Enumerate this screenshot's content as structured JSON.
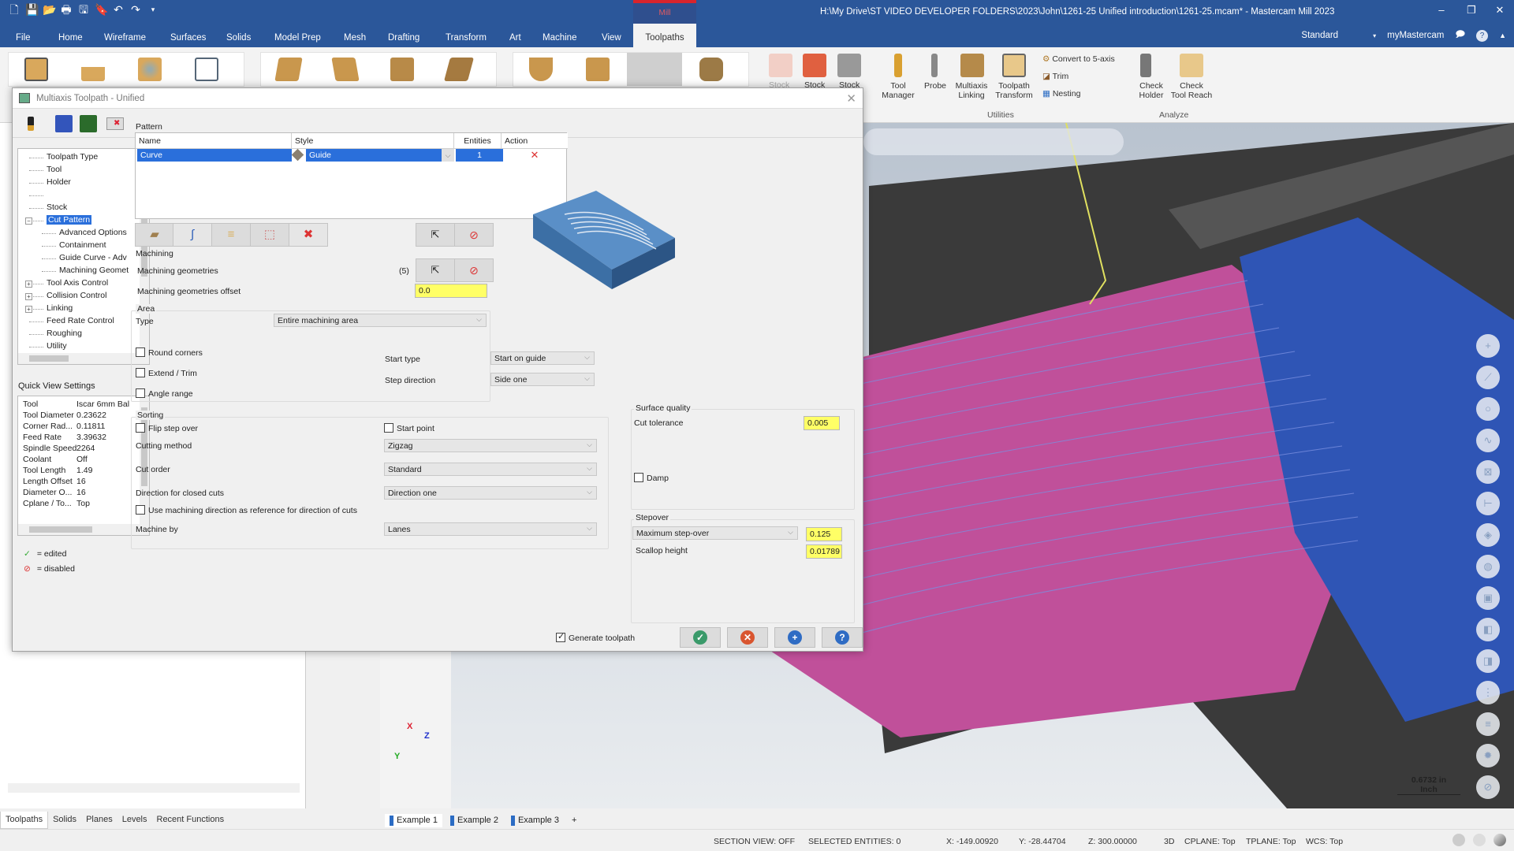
{
  "app": {
    "window_title": "H:\\My Drive\\ST VIDEO DEVELOPER FOLDERS\\2023\\John\\1261-25 Unified introduction\\1261-25.mcam* - Mastercam Mill 2023",
    "context_tab_header": "Mill",
    "window_controls": {
      "minimize": "–",
      "restore": "❐",
      "close": "✕"
    }
  },
  "ribbon": {
    "tabs": [
      "File",
      "Home",
      "Wireframe",
      "Surfaces",
      "Solids",
      "Model Prep",
      "Mesh",
      "Drafting",
      "Transform",
      "Art",
      "Machine",
      "View",
      "Toolpaths"
    ],
    "active_tab": "Toolpaths",
    "right": {
      "workspace": "Standard",
      "account": "myMastercam"
    },
    "stock_labels": [
      "Stock",
      "Stock",
      "Stock"
    ],
    "utilities": {
      "group_label": "Utilities",
      "tool_manager": "Tool\nManager",
      "tool_manager_l1": "Tool",
      "tool_manager_l2": "Manager",
      "probe": "Probe",
      "multiaxis_l1": "Multiaxis",
      "multiaxis_l2": "Linking",
      "transform_l1": "Toolpath",
      "transform_l2": "Transform",
      "convert": "Convert to 5-axis",
      "trim": "Trim",
      "nesting": "Nesting"
    },
    "analyze": {
      "group_label": "Analyze",
      "check_holder_l1": "Check",
      "check_holder_l2": "Holder",
      "check_reach_l1": "Check",
      "check_reach_l2": "Tool Reach"
    }
  },
  "dialog": {
    "title": "Multiaxis Toolpath - Unified",
    "tree": {
      "items": [
        {
          "label": "Toolpath Type",
          "level": 0
        },
        {
          "label": "Tool",
          "level": 0
        },
        {
          "label": "Holder",
          "level": 0
        },
        {
          "label": "",
          "level": 0
        },
        {
          "label": "Stock",
          "level": 0
        },
        {
          "label": "Cut Pattern",
          "level": 0,
          "selected": true,
          "expander": "−"
        },
        {
          "label": "Advanced Options",
          "level": 1
        },
        {
          "label": "Containment",
          "level": 1
        },
        {
          "label": "Guide Curve - Adv",
          "level": 1
        },
        {
          "label": "Machining Geomet",
          "level": 1
        },
        {
          "label": "Tool Axis Control",
          "level": 0,
          "expander": "+"
        },
        {
          "label": "Collision Control",
          "level": 0,
          "expander": "+"
        },
        {
          "label": "Linking",
          "level": 0,
          "expander": "+"
        },
        {
          "label": "Feed Rate Control",
          "level": 0
        },
        {
          "label": "Roughing",
          "level": 0
        },
        {
          "label": "Utility",
          "level": 0
        }
      ]
    },
    "quick_view": {
      "label": "Quick View Settings",
      "rows": [
        {
          "k": "Tool",
          "v": "Iscar 6mm Bal"
        },
        {
          "k": "Tool Diameter",
          "v": "0.23622"
        },
        {
          "k": "Corner Rad...",
          "v": "0.11811"
        },
        {
          "k": "Feed Rate",
          "v": "3.39632"
        },
        {
          "k": "Spindle Speed",
          "v": "2264"
        },
        {
          "k": "Coolant",
          "v": "Off"
        },
        {
          "k": "Tool Length",
          "v": "1.49"
        },
        {
          "k": "Length Offset",
          "v": "16"
        },
        {
          "k": "Diameter O...",
          "v": "16"
        },
        {
          "k": "Cplane / To...",
          "v": "Top"
        }
      ]
    },
    "legend": {
      "edited": "= edited",
      "disabled": "= disabled"
    },
    "pattern": {
      "legend": "Pattern",
      "columns": [
        "Name",
        "Style",
        "Entities",
        "Action"
      ],
      "rows": [
        {
          "name": "Curve",
          "style": "Guide",
          "entities": "1",
          "action": "✕"
        }
      ]
    },
    "machining": {
      "legend": "Machining",
      "geometries_label": "Machining geometries",
      "geometries_count": "(5)",
      "offset_label": "Machining geometries offset",
      "offset_value": "0.0"
    },
    "area": {
      "legend": "Area",
      "type_label": "Type",
      "type_value": "Entire machining area",
      "round_corners": "Round corners",
      "extend_trim": "Extend / Trim",
      "angle_range": "Angle range",
      "start_type_label": "Start type",
      "start_type_value": "Start on guide",
      "step_direction_label": "Step direction",
      "step_direction_value": "Side one"
    },
    "sorting": {
      "legend": "Sorting",
      "flip_step_over": "Flip step over",
      "start_point": "Start point",
      "cutting_method_label": "Cutting method",
      "cutting_method_value": "Zigzag",
      "cut_order_label": "Cut order",
      "cut_order_value": "Standard",
      "closed_dir_label": "Direction for closed cuts",
      "closed_dir_value": "Direction one",
      "use_machining_dir": "Use machining direction as reference for direction of cuts",
      "machine_by_label": "Machine by",
      "machine_by_value": "Lanes"
    },
    "surface_quality": {
      "legend": "Surface quality",
      "cut_tolerance_label": "Cut tolerance",
      "cut_tolerance_value": "0.005",
      "damp": "Damp"
    },
    "stepover": {
      "legend": "Stepover",
      "mode_value": "Maximum step-over",
      "mode_number": "0.125",
      "scallop_label": "Scallop height",
      "scallop_value": "0.01789"
    },
    "generate_toolpath": "Generate toolpath",
    "generate_checked": true
  },
  "left_bottom_tabs": [
    "Toolpaths",
    "Solids",
    "Planes",
    "Levels",
    "Recent Functions"
  ],
  "doc_tabs": [
    "Example 1",
    "Example 2",
    "Example 3",
    "+"
  ],
  "viewport": {
    "axis": {
      "x": "X",
      "y": "Y",
      "z": "Z"
    },
    "scale_value": "0.6732 in",
    "scale_unit": "Inch"
  },
  "statusbar": {
    "section_view": "SECTION VIEW: OFF",
    "selected": "SELECTED ENTITIES: 0",
    "x": "X:  -149.00920",
    "y": "Y:  -28.44704",
    "z": "Z:  300.00000",
    "mode": "3D",
    "cplane": "CPLANE: Top",
    "tplane": "TPLANE: Top",
    "wcs": "WCS: Top"
  },
  "colors": {
    "accent": "#2b579a",
    "highlight": "#ffff66",
    "selection": "#2a6fdb"
  }
}
